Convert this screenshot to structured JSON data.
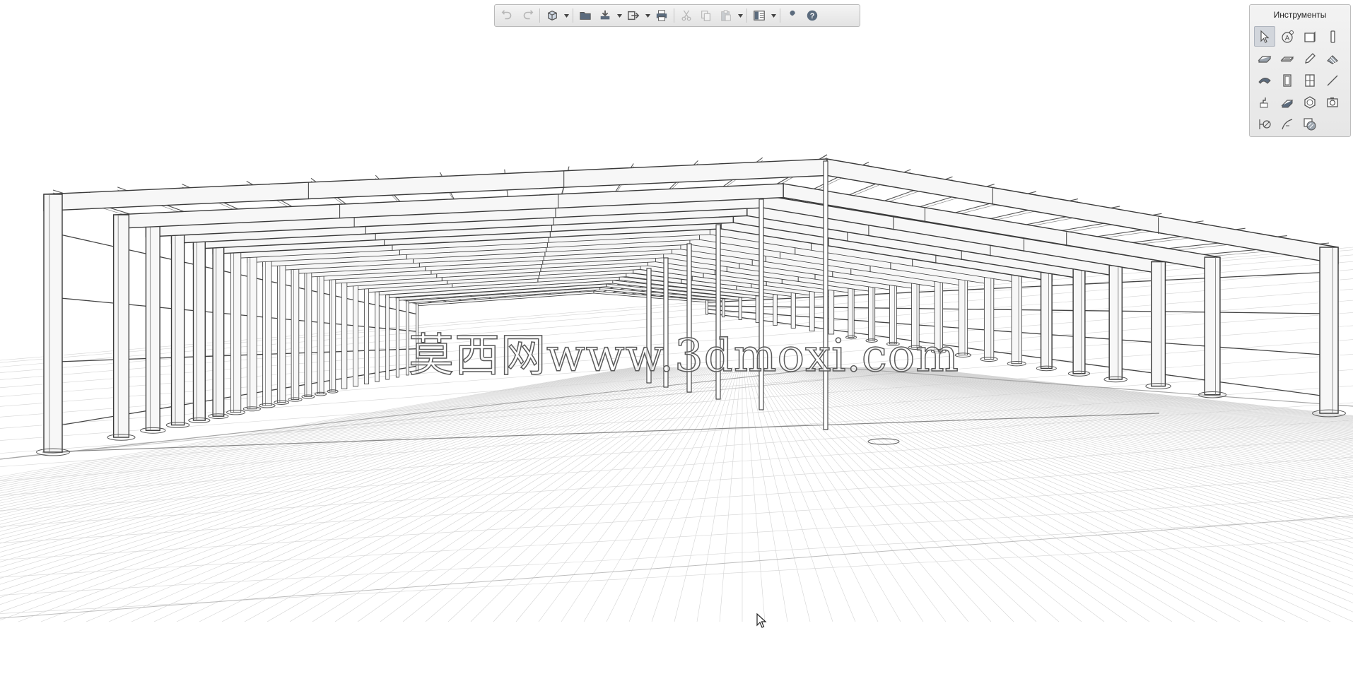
{
  "toolbar": {
    "items": [
      {
        "id": "undo",
        "icon": "undo-icon",
        "enabled": false
      },
      {
        "id": "redo",
        "icon": "redo-icon",
        "enabled": false
      },
      {
        "id": "view3d",
        "icon": "cube-view-icon",
        "dropdown": true
      },
      {
        "id": "open",
        "icon": "folder-icon"
      },
      {
        "id": "import",
        "icon": "import-icon",
        "dropdown": true
      },
      {
        "id": "export",
        "icon": "export-icon",
        "dropdown": true
      },
      {
        "id": "print",
        "icon": "printer-icon"
      },
      {
        "id": "cut",
        "icon": "scissors-icon",
        "enabled": false
      },
      {
        "id": "copy",
        "icon": "copy-icon",
        "enabled": false
      },
      {
        "id": "paste",
        "icon": "paste-icon",
        "dropdown": true,
        "enabled": false
      },
      {
        "id": "layout",
        "icon": "layout-icon",
        "dropdown": true
      },
      {
        "id": "settings",
        "icon": "wrench-icon"
      },
      {
        "id": "help",
        "icon": "help-icon"
      }
    ]
  },
  "palette": {
    "title": "Инструменты",
    "tools": [
      "select-arrow-icon",
      "text-annotation-icon",
      "wall-icon",
      "column-icon",
      "slab-icon",
      "beam-icon",
      "pencil-icon",
      "roof-icon",
      "shell-icon",
      "door-icon",
      "window-icon",
      "line-icon",
      "stair-icon",
      "railing-icon",
      "object-icon",
      "camera-icon",
      "dimension-icon",
      "arc-icon",
      "hatch-icon"
    ],
    "active_tool": "select-arrow-icon"
  },
  "watermark": "莫西网www.3dmoxi.com",
  "colors": {
    "line": "#3a3a3a",
    "grid": "#d4d4d4",
    "steel_face": "#f7f7f7",
    "toolbar_bg": "#e9e9e9",
    "icon": "#555555"
  }
}
